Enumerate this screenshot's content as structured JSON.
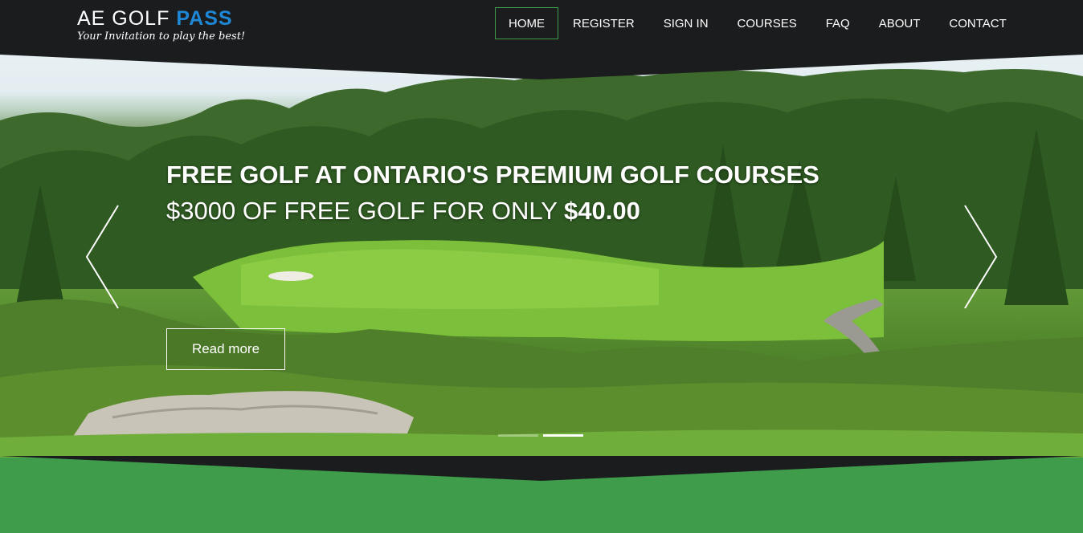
{
  "brand": {
    "name_light": "AE GOLF",
    "name_bold": "PASS",
    "tagline": "Your Invitation to play the best!"
  },
  "nav": {
    "items": [
      {
        "label": "HOME",
        "active": true
      },
      {
        "label": "REGISTER",
        "active": false
      },
      {
        "label": "SIGN IN",
        "active": false
      },
      {
        "label": "COURSES",
        "active": false
      },
      {
        "label": "FAQ",
        "active": false
      },
      {
        "label": "ABOUT",
        "active": false
      },
      {
        "label": "CONTACT",
        "active": false
      }
    ]
  },
  "hero": {
    "headline": "FREE GOLF AT ONTARIO'S PREMIUM GOLF COURSES",
    "subline_text": "$3000 OF FREE GOLF FOR ONLY",
    "subline_price": "$40.00",
    "button_label": "Read more",
    "prev_icon": "chevron-left-icon",
    "next_icon": "chevron-right-icon",
    "slides": 2,
    "active_slide": 2
  },
  "colors": {
    "header_bg": "#1b1c1e",
    "accent_green": "#3e9c4a",
    "logo_blue": "#1e88d6",
    "text": "#ffffff"
  }
}
